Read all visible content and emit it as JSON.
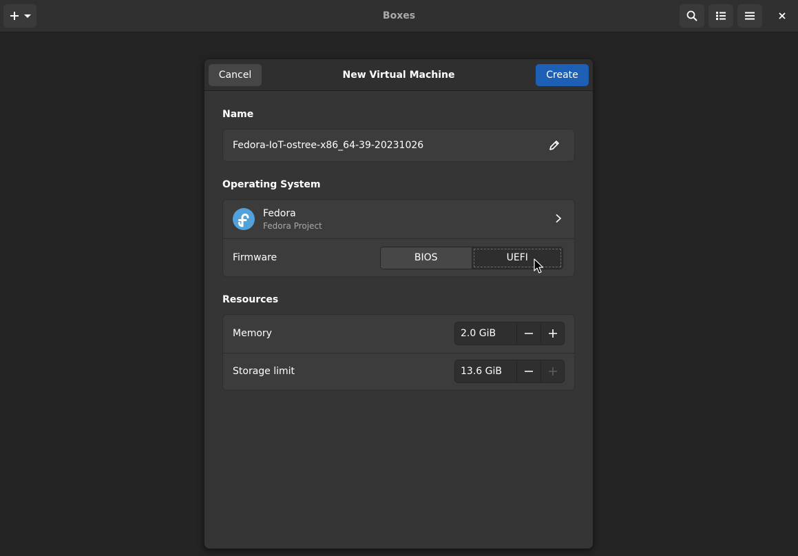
{
  "app": {
    "title": "Boxes"
  },
  "headerbar": {
    "icons": {
      "new": "plus-icon",
      "new_menu": "chevron-down-icon",
      "search": "search-icon",
      "view": "list-view-icon",
      "menu": "hamburger-menu-icon",
      "close": "close-icon"
    }
  },
  "dialog": {
    "title": "New Virtual Machine",
    "cancel_label": "Cancel",
    "create_label": "Create",
    "name_section": {
      "label": "Name",
      "value": "Fedora-IoT-ostree-x86_64-39-20231026"
    },
    "os_section": {
      "label": "Operating System",
      "os_name": "Fedora",
      "os_vendor": "Fedora Project",
      "firmware_label": "Firmware",
      "firmware_options": [
        "BIOS",
        "UEFI"
      ],
      "firmware_selected": "UEFI"
    },
    "resources_section": {
      "label": "Resources",
      "memory_label": "Memory",
      "memory_value": "2.0 GiB",
      "storage_label": "Storage limit",
      "storage_value": "13.6 GiB"
    }
  },
  "colors": {
    "accent": "#1c5fb5",
    "fedora_logo": "#51a2da",
    "background": "#242424"
  }
}
